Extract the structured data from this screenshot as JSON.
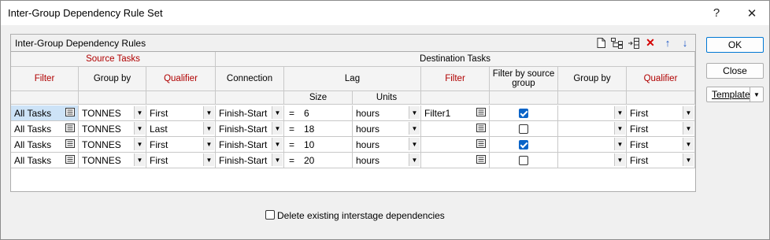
{
  "window": {
    "title": "Inter-Group Dependency Rule Set",
    "help_icon": "?",
    "close_icon": "✕"
  },
  "panel": {
    "title": "Inter-Group Dependency Rules",
    "toolbar": [
      "new-icon",
      "insert-child-icon",
      "insert-row-icon",
      "delete-icon",
      "move-up-icon",
      "move-down-icon"
    ]
  },
  "headers": {
    "source_group": "Source Tasks",
    "destination_group": "Destination Tasks",
    "source_filter": "Filter",
    "source_group_by": "Group by",
    "source_qualifier": "Qualifier",
    "connection": "Connection",
    "lag": "Lag",
    "lag_size": "Size",
    "lag_units": "Units",
    "dest_filter": "Filter",
    "filter_by_source": "Filter by source group",
    "dest_group_by": "Group by",
    "dest_qualifier": "Qualifier"
  },
  "rows": [
    {
      "filter": "All Tasks",
      "group_by": "TONNES",
      "qualifier": "First",
      "connection": "Finish-Start",
      "eq": "=",
      "size": "6",
      "units": "hours",
      "dest_filter": "Filter1",
      "filter_by_source": true,
      "dest_group_by": "",
      "dest_qualifier": "First"
    },
    {
      "filter": "All Tasks",
      "group_by": "TONNES",
      "qualifier": "Last",
      "connection": "Finish-Start",
      "eq": "=",
      "size": "18",
      "units": "hours",
      "dest_filter": "",
      "filter_by_source": false,
      "dest_group_by": "",
      "dest_qualifier": "First"
    },
    {
      "filter": "All Tasks",
      "group_by": "TONNES",
      "qualifier": "First",
      "connection": "Finish-Start",
      "eq": "=",
      "size": "10",
      "units": "hours",
      "dest_filter": "",
      "filter_by_source": true,
      "dest_group_by": "",
      "dest_qualifier": "First"
    },
    {
      "filter": "All Tasks",
      "group_by": "TONNES",
      "qualifier": "First",
      "connection": "Finish-Start",
      "eq": "=",
      "size": "20",
      "units": "hours",
      "dest_filter": "",
      "filter_by_source": false,
      "dest_group_by": "",
      "dest_qualifier": "First"
    }
  ],
  "buttons": {
    "ok": "OK",
    "close": "Close",
    "template": "Template"
  },
  "delete_existing": {
    "label": "Delete existing interstage dependencies",
    "checked": false
  },
  "colors": {
    "header_red": "#b00000",
    "checkbox_blue": "#0a64c8",
    "selection": "#cde3f7",
    "toolbar_red": "#d40000",
    "toolbar_blue": "#1a56c4"
  }
}
